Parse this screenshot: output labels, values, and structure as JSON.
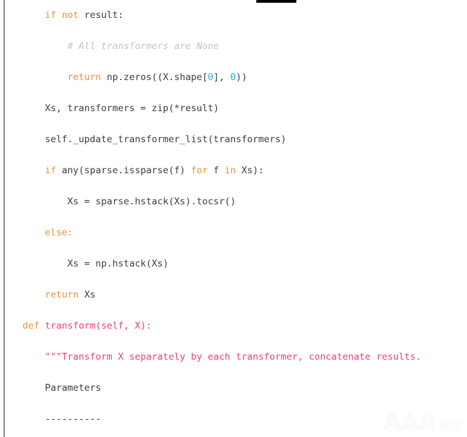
{
  "meta": {
    "language": "python",
    "background_color": "#ffffff",
    "gutter_rule_color": "#8a8a8a",
    "top_bar_color": "#000000"
  },
  "theme": {
    "keyword_color": "#e8913a",
    "plain_color": "#3b3b48",
    "number_color": "#2fa8d8",
    "comment_color": "#c2c4cc",
    "function_name_color": "#e8436f",
    "string_color": "#e8436f"
  },
  "code": {
    "lines": [
      {
        "indent": "        ",
        "tokens": [
          {
            "t": "if",
            "c": "kw"
          },
          {
            "t": " ",
            "c": "plain"
          },
          {
            "t": "not",
            "c": "op-kw"
          },
          {
            "t": " result:",
            "c": "plain"
          }
        ]
      },
      {
        "indent": "            ",
        "tokens": [
          {
            "t": "# All transformers are None",
            "c": "comment"
          }
        ]
      },
      {
        "indent": "            ",
        "tokens": [
          {
            "t": "return",
            "c": "kw"
          },
          {
            "t": " np.zeros((X.shape[",
            "c": "plain"
          },
          {
            "t": "0",
            "c": "num"
          },
          {
            "t": "], ",
            "c": "plain"
          },
          {
            "t": "0",
            "c": "num"
          },
          {
            "t": "))",
            "c": "plain"
          }
        ]
      },
      {
        "indent": "        ",
        "tokens": [
          {
            "t": "Xs, transformers = zip(*result)",
            "c": "plain"
          }
        ]
      },
      {
        "indent": "        ",
        "tokens": [
          {
            "t": "self._update_transformer_list(transformers)",
            "c": "plain"
          }
        ]
      },
      {
        "indent": "        ",
        "tokens": [
          {
            "t": "if",
            "c": "kw"
          },
          {
            "t": " any(sparse.issparse(f) ",
            "c": "plain"
          },
          {
            "t": "for",
            "c": "kw"
          },
          {
            "t": " f ",
            "c": "plain"
          },
          {
            "t": "in",
            "c": "kw"
          },
          {
            "t": " Xs):",
            "c": "plain"
          }
        ]
      },
      {
        "indent": "            ",
        "tokens": [
          {
            "t": "Xs = sparse.hstack(Xs).tocsr()",
            "c": "plain"
          }
        ]
      },
      {
        "indent": "        ",
        "tokens": [
          {
            "t": "else:",
            "c": "kw"
          }
        ]
      },
      {
        "indent": "            ",
        "tokens": [
          {
            "t": "Xs = np.hstack(Xs)",
            "c": "plain"
          }
        ]
      },
      {
        "indent": "        ",
        "tokens": [
          {
            "t": "return",
            "c": "kw"
          },
          {
            "t": " Xs",
            "c": "plain"
          }
        ]
      },
      {
        "indent": "    ",
        "tokens": [
          {
            "t": "def",
            "c": "def"
          },
          {
            "t": " ",
            "c": "plain"
          },
          {
            "t": "transform(self, X):",
            "c": "fname"
          }
        ]
      },
      {
        "indent": "        ",
        "tokens": [
          {
            "t": "\"\"\"Transform X separately by each transformer, concatenate results.",
            "c": "string"
          }
        ]
      },
      {
        "indent": "        ",
        "tokens": [
          {
            "t": "Parameters",
            "c": "plain"
          }
        ]
      },
      {
        "indent": "        ",
        "tokens": [
          {
            "t": "----------",
            "c": "plain"
          }
        ]
      }
    ]
  },
  "watermark": {
    "primary_text": "AAA",
    "secondary_text": "教育",
    "color": "#fafafa"
  }
}
